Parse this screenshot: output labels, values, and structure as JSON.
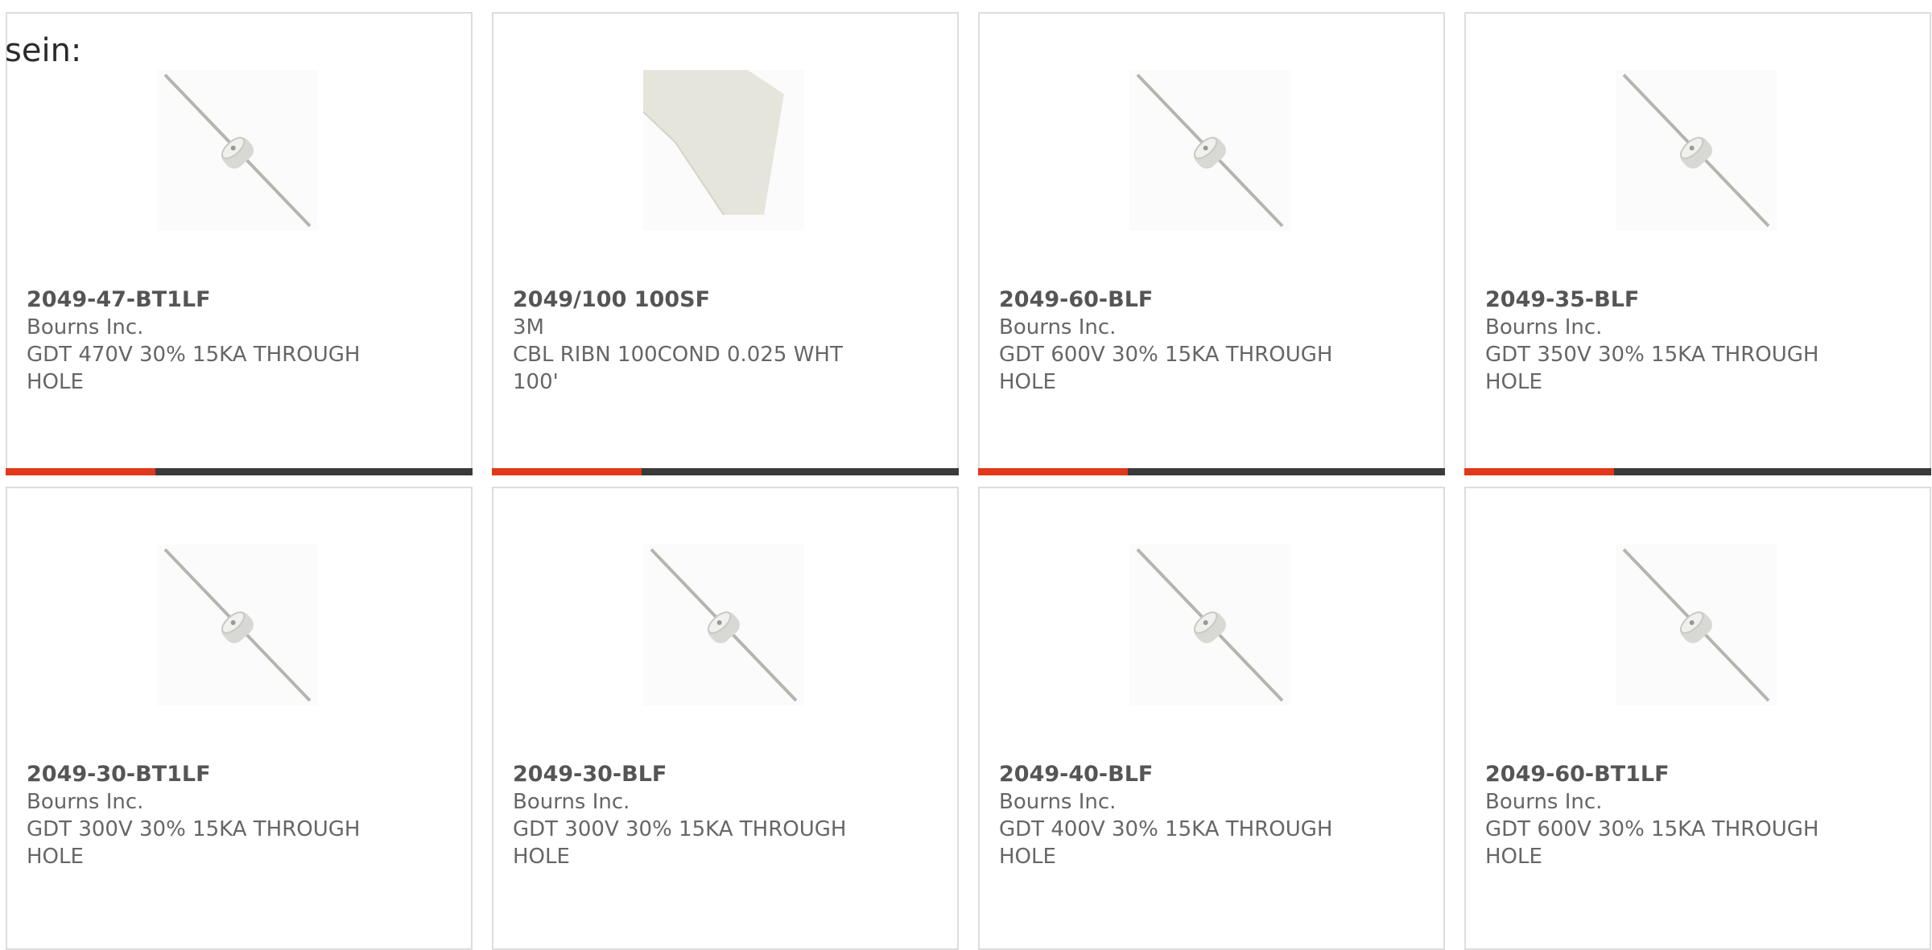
{
  "page": {
    "intro_text": "sein:"
  },
  "colors": {
    "accent": "#e2381a",
    "bar_track": "#3a3a3a",
    "card_border": "#dddddd"
  },
  "products": [
    {
      "part_number": "2049-47-BT1LF",
      "manufacturer": "Bourns Inc.",
      "description": "GDT 470V 30% 15KA THROUGH HOLE",
      "image": "gas-discharge-tube-image",
      "progress": 0.32
    },
    {
      "part_number": "2049/100 100SF",
      "manufacturer": "3M",
      "description": "CBL RIBN 100COND 0.025 WHT 100'",
      "image": "ribbon-cable-image",
      "progress": 0.32
    },
    {
      "part_number": "2049-60-BLF",
      "manufacturer": "Bourns Inc.",
      "description": "GDT 600V 30% 15KA THROUGH HOLE",
      "image": "gas-discharge-tube-image",
      "progress": 0.32
    },
    {
      "part_number": "2049-35-BLF",
      "manufacturer": "Bourns Inc.",
      "description": "GDT 350V 30% 15KA THROUGH HOLE",
      "image": "gas-discharge-tube-image",
      "progress": 0.32
    },
    {
      "part_number": "2049-30-BT1LF",
      "manufacturer": "Bourns Inc.",
      "description": "GDT 300V 30% 15KA THROUGH HOLE",
      "image": "gas-discharge-tube-image"
    },
    {
      "part_number": "2049-30-BLF",
      "manufacturer": "Bourns Inc.",
      "description": "GDT 300V 30% 15KA THROUGH HOLE",
      "image": "gas-discharge-tube-image"
    },
    {
      "part_number": "2049-40-BLF",
      "manufacturer": "Bourns Inc.",
      "description": "GDT 400V 30% 15KA THROUGH HOLE",
      "image": "gas-discharge-tube-image"
    },
    {
      "part_number": "2049-60-BT1LF",
      "manufacturer": "Bourns Inc.",
      "description": "GDT 600V 30% 15KA THROUGH HOLE",
      "image": "gas-discharge-tube-image"
    }
  ]
}
